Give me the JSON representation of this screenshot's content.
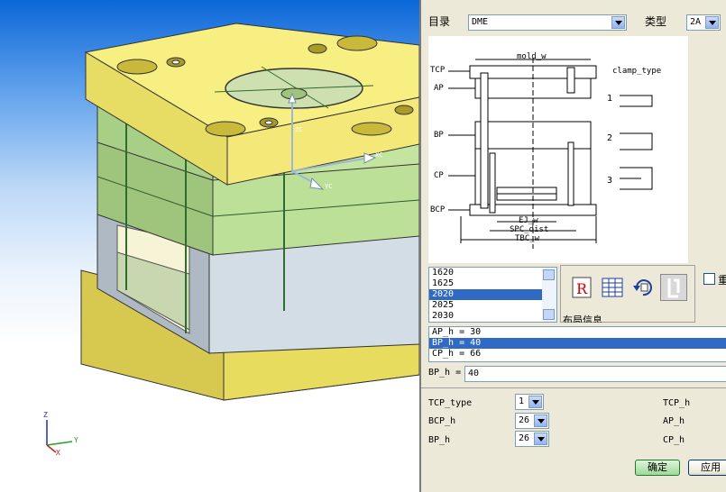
{
  "dialog": {
    "catalog_label": "目录",
    "catalog_value": "DME",
    "type_label": "类型",
    "type_value": "2A",
    "diagram": {
      "mold_w": "mold_w",
      "tcp": "TCP",
      "ap": "AP",
      "bp": "BP",
      "cp": "CP",
      "bcp": "BCP",
      "ej_w": "EJ_w",
      "spc_dist": "SPC_dist",
      "tbc_w": "TBC_w",
      "clamp_type": "clamp_type",
      "clamp_1": "1",
      "clamp_2": "2",
      "clamp_3": "3"
    },
    "size_list": [
      "1620",
      "1625",
      "2020",
      "2025",
      "2030"
    ],
    "size_selected": "2020",
    "layout_info_label": "布局信息",
    "checkbox_label": "重",
    "param_list": [
      "AP_h = 30",
      "BP_h = 40",
      "CP_h = 66"
    ],
    "param_selected": "BP_h = 40",
    "edit_label": "BP_h =",
    "edit_value": "40",
    "fields": {
      "tcp_type_label": "TCP_type",
      "tcp_type_value": "1",
      "bcp_h_label": "BCP_h",
      "bcp_h_value": "26",
      "bp_h_label": "BP_h",
      "bp_h_value": "26",
      "tcp_h_label": "TCP_h",
      "ap_h_label": "AP_h",
      "cp_h_label": "CP_h"
    },
    "ok_label": "确定",
    "apply_label": "应用"
  },
  "viewport": {
    "axis_x": "X",
    "axis_y": "Y",
    "axis_z": "Z",
    "csys_zc": "ZC",
    "csys_xc": "XC",
    "csys_yc": "YC"
  },
  "colors": {
    "plate_yellow": "#f5ec86",
    "plate_green": "#b9dc90",
    "plate_grey": "#cfd9e3",
    "selection": "#316ac5",
    "dialog_bg": "#ece9d8"
  }
}
